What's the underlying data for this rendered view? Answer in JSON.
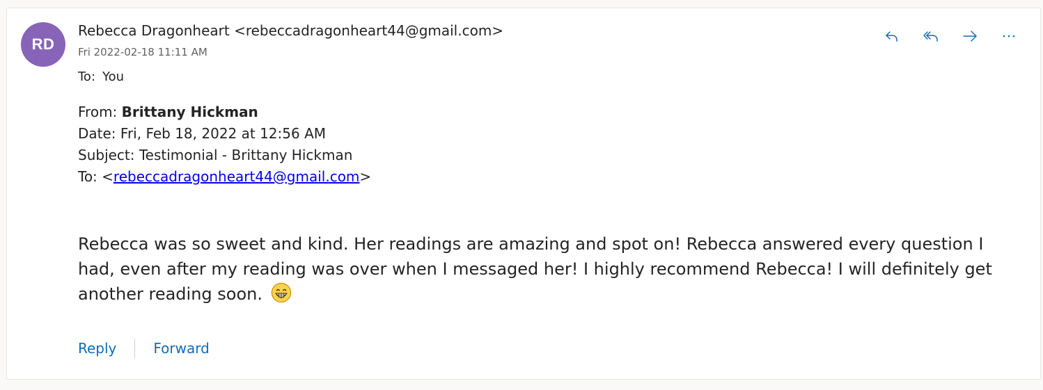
{
  "header": {
    "avatar_initials": "RD",
    "avatar_color": "#8764b8",
    "sender_name": "Rebecca Dragonheart",
    "sender_email": "<rebeccadragonheart44@gmail.com>",
    "datetime": "Fri 2022-02-18 11:11 AM",
    "to_label": "To:",
    "to_value": "You"
  },
  "actions": [
    {
      "name": "reply",
      "icon": "reply-icon"
    },
    {
      "name": "reply-all",
      "icon": "reply-all-icon"
    },
    {
      "name": "forward",
      "icon": "forward-icon"
    },
    {
      "name": "more",
      "icon": "more-icon"
    }
  ],
  "forwarded": {
    "from_label": "From:",
    "from_name": "Brittany Hickman",
    "date_line": "Date: Fri, Feb 18, 2022 at 12:56 AM",
    "subject_line": "Subject: Testimonial - Brittany Hickman",
    "to_label": "To: <",
    "to_email": "rebeccadragonheart44@gmail.com",
    "to_close": ">"
  },
  "body": {
    "text": "Rebecca was so sweet and kind. Her readings are amazing and spot on! Rebecca answered every question I had, even after my reading was over when I messaged her! I highly recommend Rebecca! I will definitely get another reading soon.",
    "emoji": "grinning-face-with-smiling-eyes-emoji"
  },
  "footer": {
    "reply_label": "Reply",
    "forward_label": "Forward"
  },
  "colors": {
    "accent": "#0f6cbd",
    "link": "#0000ee",
    "text": "#242424",
    "muted": "#616161"
  }
}
